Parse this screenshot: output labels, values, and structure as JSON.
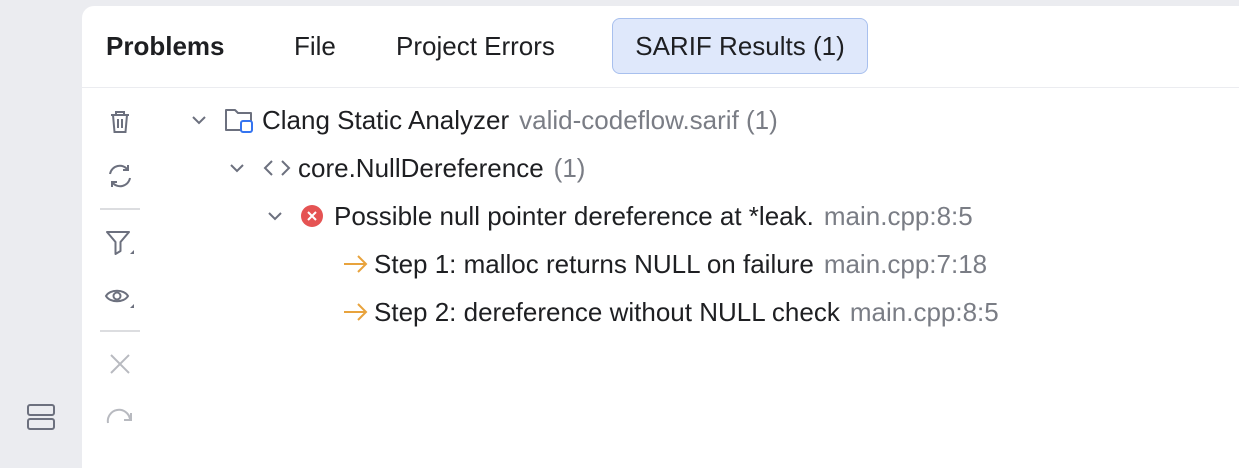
{
  "tabs": {
    "title": "Problems",
    "file": "File",
    "project_errors": "Project Errors",
    "sarif_results": "SARIF Results (1)"
  },
  "toolbar": {
    "icons": [
      "trash-icon",
      "refresh-icon",
      "filter-icon",
      "eye-icon",
      "close-icon",
      "redo-icon"
    ]
  },
  "tree": {
    "analyzer": {
      "name": "Clang Static Analyzer",
      "file": "valid-codeflow.sarif (1)"
    },
    "rule": {
      "name": "core.NullDereference",
      "count": "(1)"
    },
    "issue": {
      "message": "Possible null pointer dereference at *leak.",
      "location": "main.cpp:8:5"
    },
    "steps": [
      {
        "text": "Step 1: malloc returns NULL on failure",
        "location": "main.cpp:7:18"
      },
      {
        "text": "Step 2: dereference without NULL check",
        "location": "main.cpp:8:5"
      }
    ]
  },
  "colors": {
    "selected_tab_bg": "#dfe8fb",
    "selected_tab_border": "#a8c0ee",
    "error_red": "#e55353",
    "step_arrow": "#e8a33d",
    "muted_text": "#7a7d85"
  }
}
